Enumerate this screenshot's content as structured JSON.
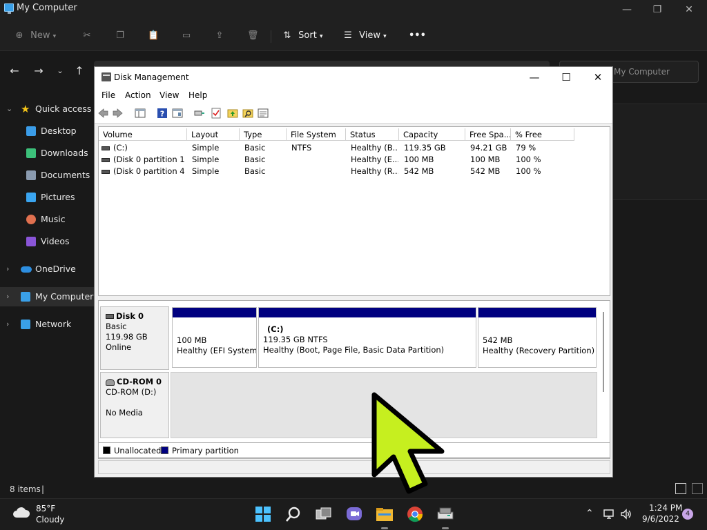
{
  "explorer": {
    "title": "My Computer",
    "window_controls": {
      "minimize": "—",
      "maximize": "❐",
      "close": "✕"
    },
    "commands": {
      "new": "New",
      "sort": "Sort",
      "view": "View",
      "more": "•••"
    },
    "search_placeholder": "My Computer",
    "sidebar": [
      {
        "label": "Quick access",
        "icon": "star-icon",
        "color": "#f5c518"
      },
      {
        "label": "Desktop",
        "icon": "desktop-icon",
        "color": "#3b9de8"
      },
      {
        "label": "Downloads",
        "icon": "download-icon",
        "color": "#3cc07a"
      },
      {
        "label": "Documents",
        "icon": "document-icon",
        "color": "#8a9bb0"
      },
      {
        "label": "Pictures",
        "icon": "pictures-icon",
        "color": "#3aa5f0"
      },
      {
        "label": "Music",
        "icon": "music-icon",
        "color": "#e0704f"
      },
      {
        "label": "Videos",
        "icon": "videos-icon",
        "color": "#8a55d8"
      },
      {
        "label": "OneDrive",
        "icon": "cloud-icon",
        "color": "#2d8ee0"
      },
      {
        "label": "My Computer",
        "icon": "computer-icon",
        "color": "#3aa0e8"
      },
      {
        "label": "Network",
        "icon": "network-icon",
        "color": "#3aa0e8"
      }
    ],
    "status": {
      "item_count": "8 items",
      "separator": "|"
    }
  },
  "disk_management": {
    "title": "Disk Management",
    "window_controls": {
      "minimize": "—",
      "maximize": "☐",
      "close": "✕"
    },
    "menu": [
      "File",
      "Action",
      "View",
      "Help"
    ],
    "columns": [
      "Volume",
      "Layout",
      "Type",
      "File System",
      "Status",
      "Capacity",
      "Free Spa...",
      "% Free"
    ],
    "volumes": [
      {
        "volume": "(C:)",
        "layout": "Simple",
        "type": "Basic",
        "fs": "NTFS",
        "status": "Healthy (B...",
        "capacity": "119.35 GB",
        "free": "94.21 GB",
        "pct": "79 %"
      },
      {
        "volume": "(Disk 0 partition 1)",
        "layout": "Simple",
        "type": "Basic",
        "fs": "",
        "status": "Healthy (E...",
        "capacity": "100 MB",
        "free": "100 MB",
        "pct": "100 %"
      },
      {
        "volume": "(Disk 0 partition 4)",
        "layout": "Simple",
        "type": "Basic",
        "fs": "",
        "status": "Healthy (R...",
        "capacity": "542 MB",
        "free": "542 MB",
        "pct": "100 %"
      }
    ],
    "disk0": {
      "name": "Disk 0",
      "type": "Basic",
      "size": "119.98 GB",
      "state": "Online",
      "partitions": [
        {
          "name": "",
          "size": "100 MB",
          "status": "Healthy (EFI System P"
        },
        {
          "name": "(C:)",
          "size": "119.35 GB NTFS",
          "status": "Healthy (Boot, Page File, Basic Data Partition)"
        },
        {
          "name": "",
          "size": "542 MB",
          "status": "Healthy (Recovery Partition)"
        }
      ]
    },
    "cdrom": {
      "name": "CD-ROM 0",
      "drive": "CD-ROM (D:)",
      "media": "No Media"
    },
    "legend": [
      {
        "label": "Unallocated",
        "color": "#000000"
      },
      {
        "label": "Primary partition",
        "color": "#000080"
      }
    ]
  },
  "cursor_color": "#c6ef1f",
  "taskbar": {
    "weather_temp": "85°F",
    "weather_cond": "Cloudy",
    "time": "1:24 PM",
    "date": "9/6/2022",
    "notifications": "4"
  }
}
